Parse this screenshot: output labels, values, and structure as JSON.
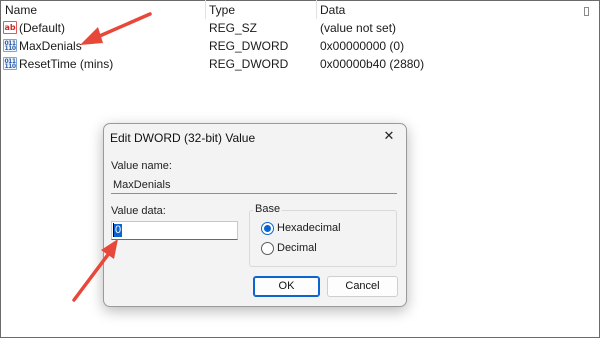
{
  "list": {
    "columns": {
      "name": "Name",
      "type": "Type",
      "data": "Data"
    },
    "rows": [
      {
        "icon": "string-value-icon",
        "icon_text": "ab",
        "name": "(Default)",
        "type": "REG_SZ",
        "data": "(value not set)"
      },
      {
        "icon": "binary-value-icon",
        "icon_text": "011 110",
        "name": "MaxDenials",
        "type": "REG_DWORD",
        "data": "0x00000000 (0)"
      },
      {
        "icon": "binary-value-icon",
        "icon_text": "011 110",
        "name": "ResetTime (mins)",
        "type": "REG_DWORD",
        "data": "0x00000b40 (2880)"
      }
    ]
  },
  "dialog": {
    "title": "Edit DWORD (32-bit) Value",
    "close_glyph": "✕",
    "value_name_label": "Value name:",
    "value_name": "MaxDenials",
    "value_data_label": "Value data:",
    "value_data": "0",
    "base_label": "Base",
    "base_options": [
      {
        "label": "Hexadecimal",
        "selected": true
      },
      {
        "label": "Decimal",
        "selected": false
      }
    ],
    "ok_label": "OK",
    "cancel_label": "Cancel"
  },
  "annotations": {
    "arrow_color": "#e8483a",
    "arrows": [
      "arrow-to-maxdenials",
      "arrow-to-value-data"
    ]
  },
  "colors": {
    "accent": "#0a64d2",
    "dialog_bg": "#f3f3f3"
  }
}
